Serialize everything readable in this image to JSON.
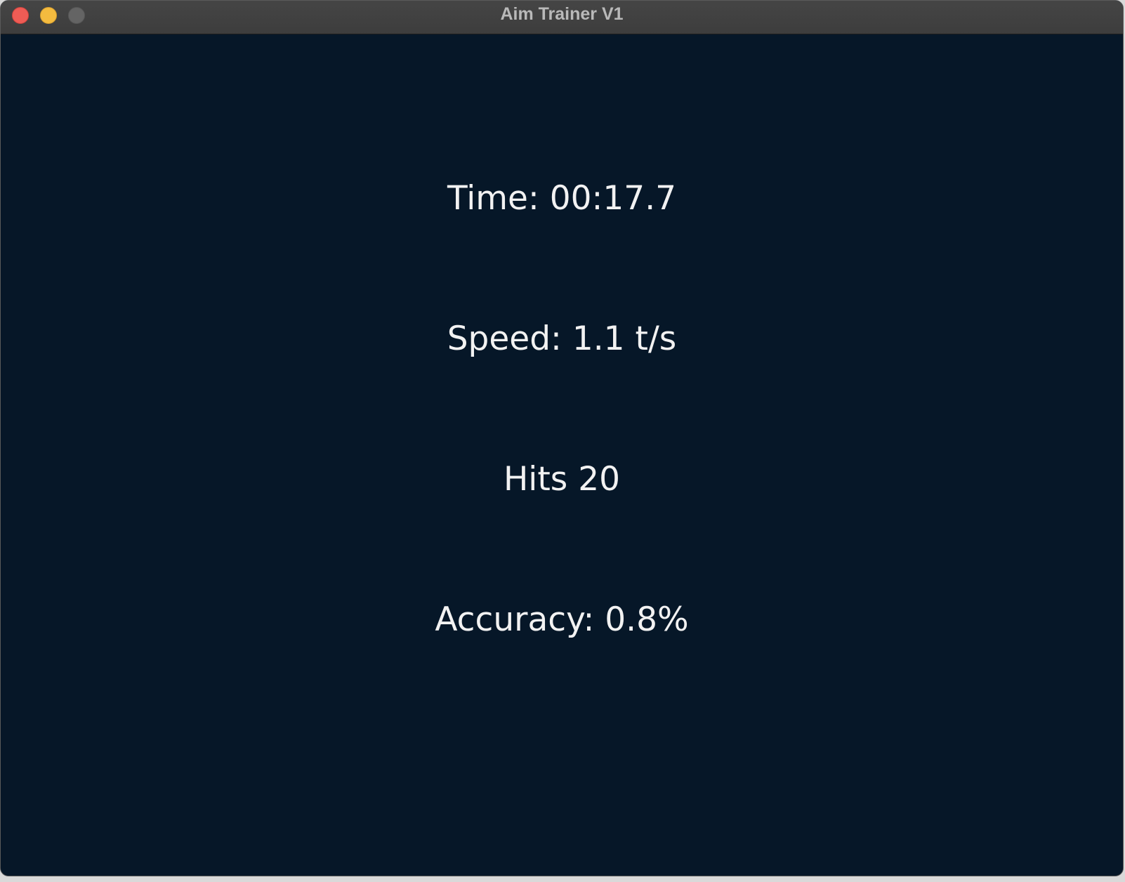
{
  "window": {
    "title": "Aim Trainer V1"
  },
  "stats": {
    "time": "Time: 00:17.7",
    "speed": "Speed: 1.1 t/s",
    "hits": "Hits 20",
    "accuracy": "Accuracy: 0.8%"
  },
  "colors": {
    "background": "#061728",
    "text": "#f2f2f2",
    "titlebar": "#424242"
  }
}
